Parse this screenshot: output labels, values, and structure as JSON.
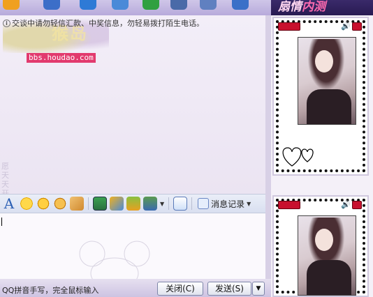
{
  "toolbar": {
    "icons": [
      "app-icon",
      "contact-icon",
      "video-icon",
      "file-icon",
      "add-icon",
      "board-icon",
      "settings-icon",
      "shield-icon"
    ]
  },
  "promo": {
    "text_a": "扇情",
    "text_b": "内测"
  },
  "chat": {
    "notice": "交谈中请勿轻信汇款、中奖信息，勿轻易拨打陌生电话。",
    "logo_word": "猴岛",
    "logo_url": "bbs.houdao.com",
    "vertical_text": "愿天天开心"
  },
  "format_toolbar": {
    "font_label": "A",
    "icons": [
      "smiley-icon",
      "magic-emoticon-icon",
      "doodle-icon",
      "shake-icon",
      "screenshot-icon",
      "music-icon",
      "gift-icon",
      "rich-text-icon",
      "soso-icon"
    ],
    "history_label": "消息记录"
  },
  "bottom": {
    "ime_status": "QQ拼音手写，完全鼠标输入",
    "close_label": "关闭(C)",
    "send_label": "发送(S)",
    "send_arrow": "▼"
  },
  "side_panel": {
    "cards": [
      {
        "speaker": "🔊"
      },
      {
        "speaker": "🔊"
      }
    ]
  },
  "colors": {
    "accent": "#2b5fb4",
    "badge": "#c8102e",
    "banner": "#281a52"
  }
}
